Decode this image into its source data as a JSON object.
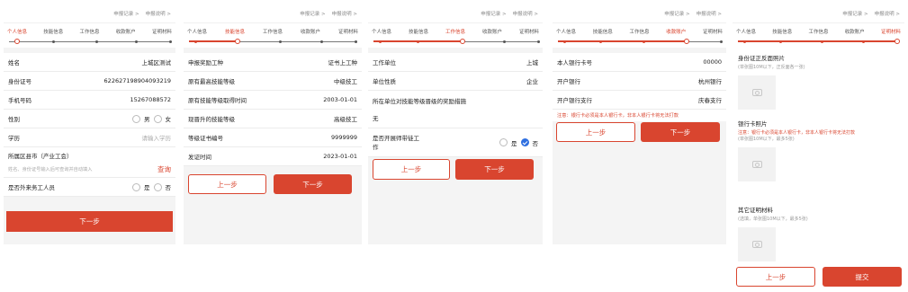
{
  "header": {
    "record_link": "申报记录 >",
    "guide_link": "申报说明 >"
  },
  "steps": [
    "个人信息",
    "技能信息",
    "工作信息",
    "收款账户",
    "证明材料"
  ],
  "panel1": {
    "fields": [
      {
        "label": "姓名",
        "value": "上城区测试"
      },
      {
        "label": "身份证号",
        "value": "622627198904093219"
      },
      {
        "label": "手机号码",
        "value": "15267088572"
      }
    ],
    "gender_label": "性别",
    "gender_male": "男",
    "gender_female": "女",
    "education_label": "学历",
    "education_placeholder": "请输入学历",
    "county_label": "所属区县市（产业工会）",
    "county_placeholder": "姓名、身份证号输入后可查询并自动填入",
    "query_button": "查询",
    "migrant_label": "是否外来务工人员",
    "yes": "是",
    "no": "否",
    "next_button": "下一步"
  },
  "panel2": {
    "fields": [
      {
        "label": "申报奖励工种",
        "value": "证书上工种"
      },
      {
        "label": "原有最高技能等级",
        "value": "中级技工"
      },
      {
        "label": "原有技能等级取得时间",
        "value": "2003-01-01"
      },
      {
        "label": "现晋升的技能等级",
        "value": "高级技工"
      },
      {
        "label": "等级证书编号",
        "value": "9999999"
      },
      {
        "label": "发证时间",
        "value": "2023-01-01"
      }
    ],
    "prev_button": "上一步",
    "next_button": "下一步"
  },
  "panel3": {
    "fields": [
      {
        "label": "工作单位",
        "value": "上城"
      },
      {
        "label": "单位性质",
        "value": "企业"
      }
    ],
    "reward_label": "所在单位对技能等级晋级的奖励措施",
    "reward_value": "无",
    "mentor_label_1": "是否开展师带徒工",
    "mentor_label_2": "作",
    "yes": "是",
    "no": "否",
    "prev_button": "上一步",
    "next_button": "下一步"
  },
  "panel4": {
    "fields": [
      {
        "label": "本人银行卡号",
        "value": "00000"
      },
      {
        "label": "开户银行",
        "value": "杭州银行"
      },
      {
        "label": "开户银行支行",
        "value": "庆春支行"
      }
    ],
    "notice": "注意：银行卡必须是本人银行卡，非本人银行卡将无法打款",
    "prev_button": "上一步",
    "next_button": "下一步"
  },
  "panel5": {
    "id_title": "身份证正反面照片",
    "id_sub": "(单张图10M以下，正反面各一张)",
    "bank_title": "银行卡照片",
    "bank_notice": "注意：银行卡必须是本人银行卡，非本人银行卡将无法打款",
    "bank_sub": "(单张图10M以下，最多5张)",
    "other_title": "其它证明材料",
    "other_sub": "(选填，单张图10M以下，最多5张)",
    "prev_button": "上一步",
    "submit_button": "提交"
  },
  "colors": {
    "accent": "#d9452f",
    "check": "#2f6fe0"
  }
}
